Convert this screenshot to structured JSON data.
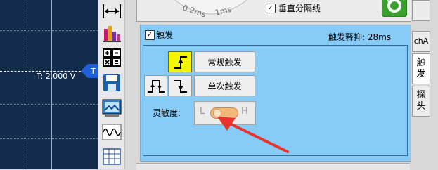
{
  "scope": {
    "trigger_level_label": "T: 2.000 V",
    "trigger_marker_label": "T"
  },
  "toolbar": {
    "icons": [
      "h-stretch-icon",
      "spectrum-icon",
      "calculator-icon",
      "save-icon",
      "image-icon",
      "waveform-icon",
      "grid-icon"
    ]
  },
  "top": {
    "dial_labels": [
      "0.2ms",
      "1ms"
    ],
    "vertical_divider_label": "垂直分隔线",
    "vertical_divider_checked": true
  },
  "trigger": {
    "enable_label": "触发",
    "enable_checked": true,
    "holdoff_label": "触发释抑: 28ms",
    "normal_label": "常规触发",
    "single_label": "单次触发",
    "sensitivity_label": "灵敏度:",
    "slider_low": "L",
    "slider_high": "H",
    "sensitivity_level": 0.3
  },
  "tabs": [
    {
      "label": "chA"
    },
    {
      "label": "触\n发"
    },
    {
      "label": "探\n头"
    }
  ],
  "colors": {
    "scope_bg": "#132c4c",
    "panel_blue": "#87cbf7",
    "selected_yellow": "#f5f500",
    "arrow_red": "#e8332f"
  }
}
